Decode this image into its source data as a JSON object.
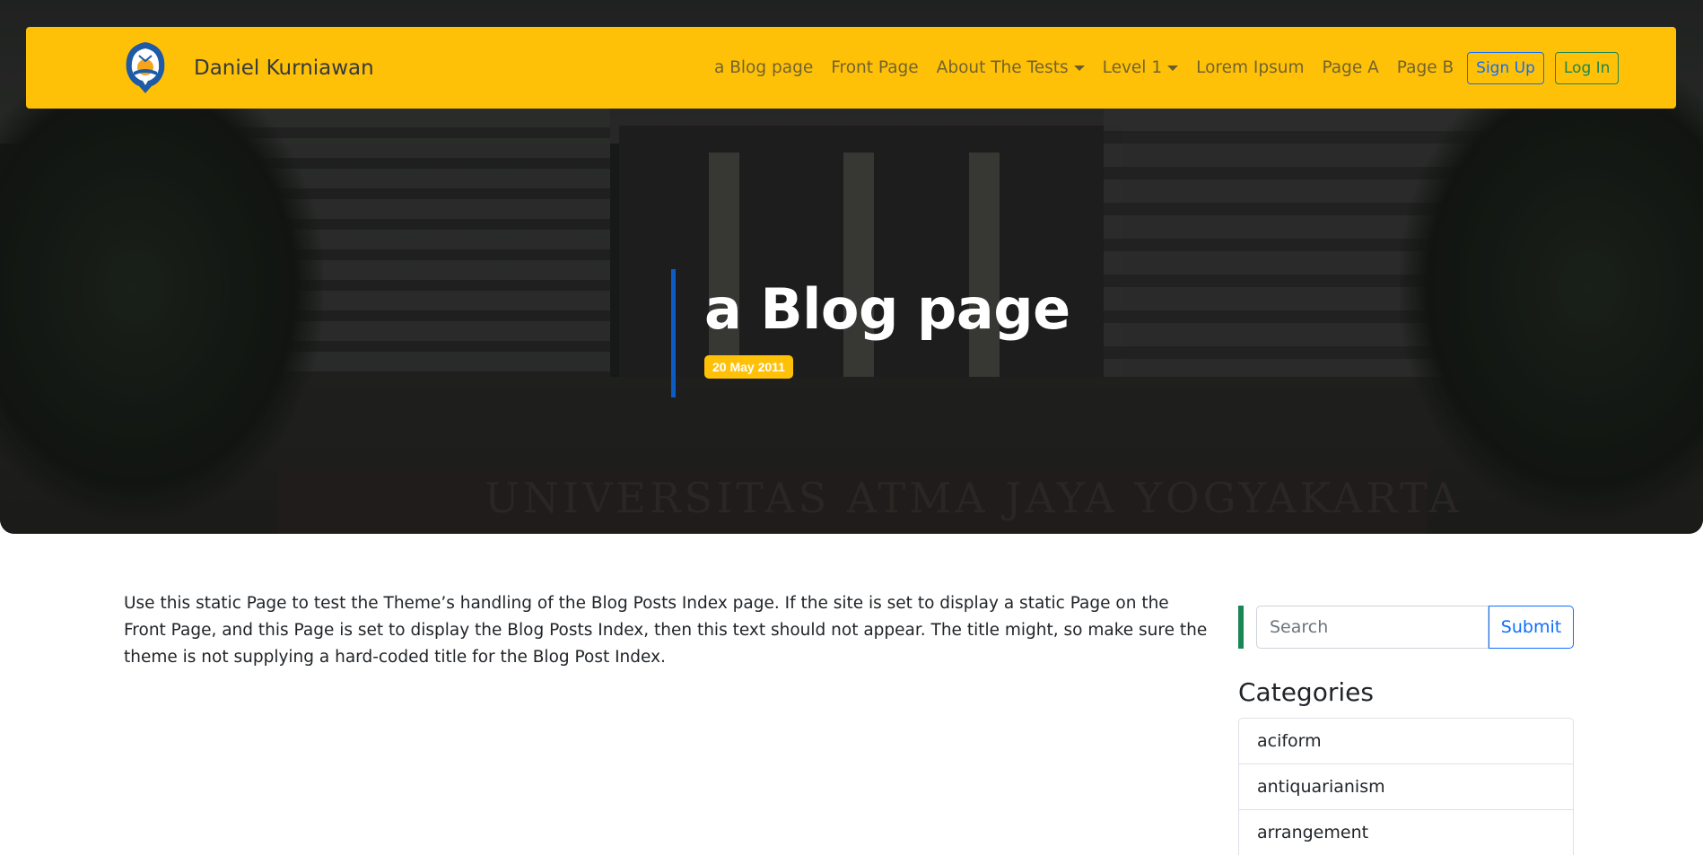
{
  "navbar": {
    "brand_name": "Daniel Kurniawan",
    "links": [
      {
        "label": "a Blog page",
        "has_dropdown": false
      },
      {
        "label": "Front Page",
        "has_dropdown": false
      },
      {
        "label": "About The Tests",
        "has_dropdown": true
      },
      {
        "label": "Level 1",
        "has_dropdown": true
      },
      {
        "label": "Lorem Ipsum",
        "has_dropdown": false
      },
      {
        "label": "Page A",
        "has_dropdown": false
      },
      {
        "label": "Page B",
        "has_dropdown": false
      }
    ],
    "signup_label": "Sign Up",
    "login_label": "Log In",
    "background_color": "#ffc107"
  },
  "hero": {
    "title": "a Blog page",
    "date": "20 May 2011",
    "wall_text": "UNIVERSITAS ATMA JAYA YOGYAKARTA",
    "accent_color": "#0b5cc4"
  },
  "content": {
    "body": "Use this static Page to test the Theme’s handling of the Blog Posts Index page. If the site is set to display a static Page on the Front Page, and this Page is set to display the Blog Posts Index, then this text should not appear. The title might, so make sure the theme is not supplying a hard-coded title for the Blog Post Index."
  },
  "sidebar": {
    "search": {
      "placeholder": "Search",
      "submit_label": "Submit"
    },
    "categories_heading": "Categories",
    "categories": [
      "aciform",
      "antiquarianism",
      "arrangement"
    ]
  }
}
